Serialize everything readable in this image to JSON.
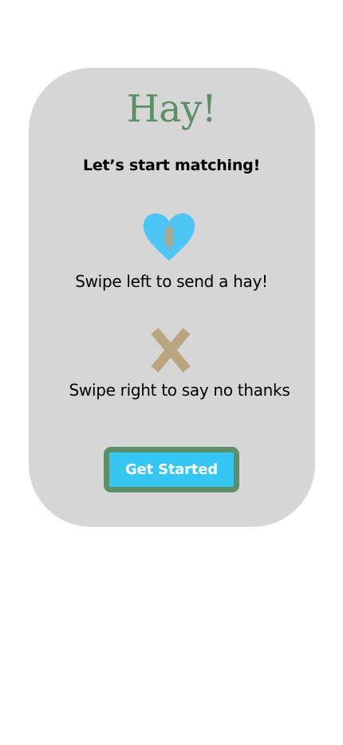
{
  "onboarding": {
    "title": "Hay!",
    "subtitle": "Let’s start matching!",
    "swipe_left_text": "Swipe left to send a hay!",
    "swipe_right_text": "Swipe right to say no thanks",
    "get_started_label": "Get Started"
  },
  "icons": {
    "like": "heart-with-wheat-icon",
    "dislike": "cross-icon"
  },
  "colors": {
    "card_background": "#d6d6d6",
    "title_green": "#5a8f68",
    "heart_blue": "#4cc6f5",
    "wheat_tan": "#b9a57e",
    "cross_tan": "#b9a57e",
    "button_blue": "#35c6f2",
    "button_border_green": "#5f8f6a"
  }
}
